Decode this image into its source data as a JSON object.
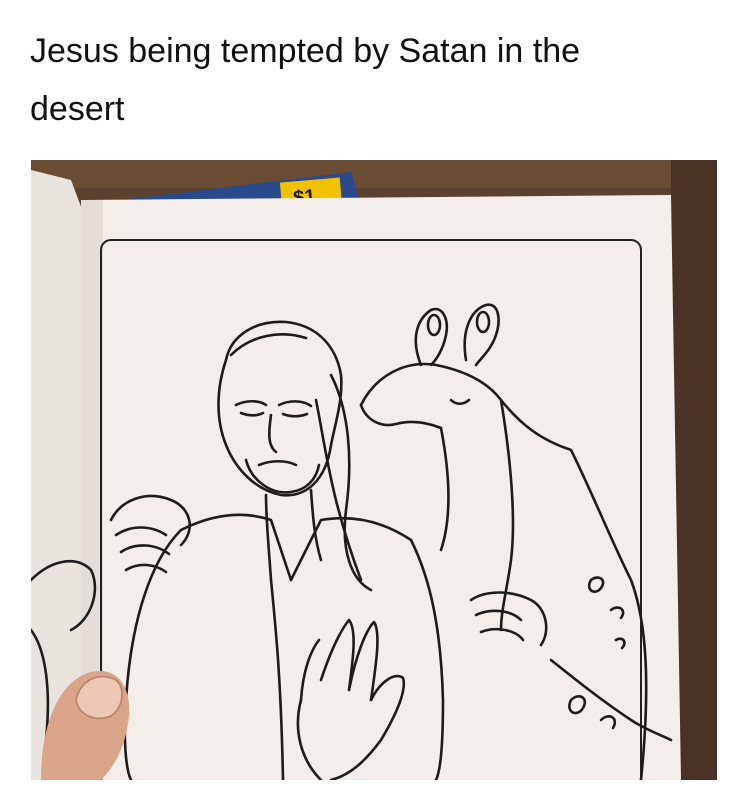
{
  "caption": {
    "line1": "Jesus being tempted by Satan in the",
    "line2": "desert"
  },
  "photo": {
    "description_icon": "coloring-book-photo",
    "price_tag_text": "$1",
    "colors": {
      "wood": "#5a3f2c",
      "page": "#f3eeea",
      "left_page": "#e9e3de",
      "ink": "#1c1c1c",
      "blue_cover": "#2a4a8c",
      "tag_yellow": "#f2c200",
      "skin": "#d9a487"
    }
  }
}
